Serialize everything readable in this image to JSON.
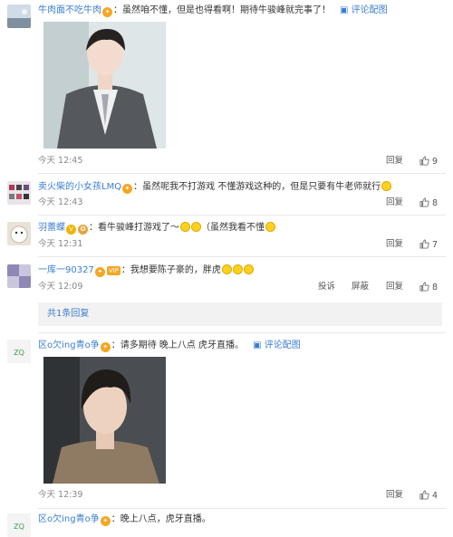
{
  "comments": [
    {
      "username": "牛肉面不吃牛肉",
      "text": "：虽然咱不懂，但是也得看啊！期待牛骏峰就完事了！",
      "pic_link": "评论配图",
      "time": "今天 12:45",
      "reply": "回复",
      "likes": "9"
    },
    {
      "username": "卖火柴的小女孩LMQ",
      "text": "：虽然呢我不打游戏 不懂游戏这种的，但是只要有牛老师就行",
      "time": "今天 12:43",
      "reply": "回复",
      "likes": "8"
    },
    {
      "username": "羽蕾蝶",
      "text": "：看牛骏峰打游戏了～",
      "text_after": "（虽然我看不懂",
      "time": "今天 12:31",
      "reply": "回复",
      "likes": "7"
    },
    {
      "username": "一库一90327",
      "vip": "VIP",
      "text": "：我想要陈子豪的，胖虎",
      "time": "今天 12:09",
      "report": "投诉",
      "block": "屏蔽",
      "reply": "回复",
      "likes": "8"
    },
    {
      "username": "区o欠ing青o争",
      "text": "：请多期待 晚上八点 虎牙直播。",
      "pic_link": "评论配图",
      "time": "今天 12:39",
      "reply": "回复",
      "likes": "4"
    },
    {
      "username": "区o欠ing青o争",
      "text": "：晚上八点，虎牙直播。"
    }
  ],
  "collapsed_replies": "共1条回复",
  "colors": {
    "link": "#3a7dd1",
    "name": "#eb7350"
  },
  "icons": [
    "badge-icon",
    "picture-icon",
    "thumb-up-icon",
    "smile-emoji-icon"
  ]
}
